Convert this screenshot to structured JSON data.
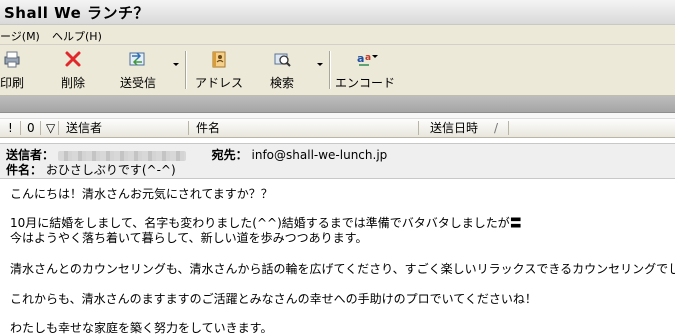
{
  "window": {
    "title": "Shall We ランチ？"
  },
  "menu": {
    "items": [
      "ージ(M)",
      "ヘルプ(H)"
    ]
  },
  "toolbar": {
    "print": "印刷",
    "delete": "削除",
    "send_receive": "送受信",
    "address": "アドレス",
    "search": "検索",
    "encode": "エンコード"
  },
  "list": {
    "columns": [
      "!",
      "0",
      "▽",
      "送信者",
      "件名",
      "送信日時"
    ]
  },
  "header": {
    "from_label": "送信者：",
    "to_label": "宛先：",
    "to_value": "info@shall-we-lunch.jp",
    "subject_label": "件名：",
    "subject_value": "おひさしぶりです(^-^)"
  },
  "message": {
    "lines": [
      "こんにちは！清水さんお元気にされてますか？？",
      "10月に結婚をしまして、名字も変わりました(^^)結婚するまでは準備でバタバタしましたが〓",
      "今はようやく落ち着いて暮らして、新しい道を歩みつつあります。",
      "清水さんとのカウンセリングも、清水さんから話の輪を広げてくださり、すごく楽しいリラックスできるカウンセリングでした。",
      "これからも、清水さんのますますのご活躍とみなさんの幸せへの手助けのプロでいてくださいね！",
      "わたしも幸せな家庭を築く努力をしていきます。"
    ]
  },
  "colors": {
    "toolbar_bg": "#ece9d8",
    "delete_x": "#e2262a",
    "header_bg": "#efefef"
  }
}
